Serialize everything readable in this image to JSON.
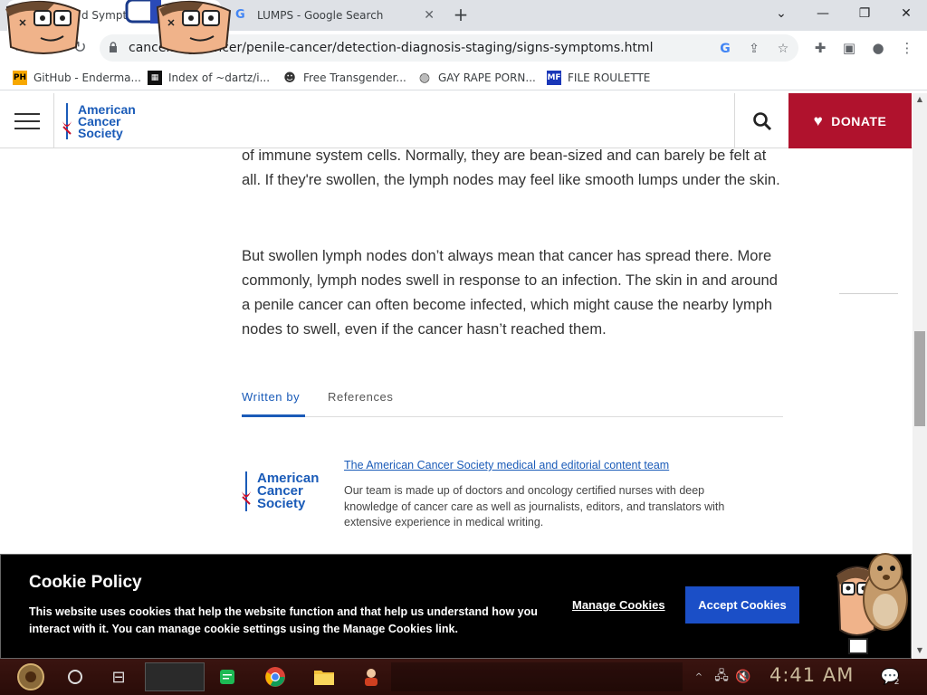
{
  "browser": {
    "tabs": [
      {
        "title": "d Sympto",
        "active": true
      },
      {
        "title": "LUMPS - Google Search",
        "active": false
      }
    ],
    "address_bar": {
      "url": "cancer.org/cancer/penile-cancer/detection-diagnosis-staging/signs-symptoms.html"
    },
    "bookmarks": [
      {
        "label": "GitHub - Enderma...",
        "icon": "ph-favicon"
      },
      {
        "label": "Index of ~dartz/i...",
        "icon": "qr-favicon"
      },
      {
        "label": "Free Transgender...",
        "icon": "mask-favicon"
      },
      {
        "label": "GAY RAPE PORN...",
        "icon": "globe-favicon"
      },
      {
        "label": "FILE ROULETTE",
        "icon": "mf-favicon"
      }
    ]
  },
  "site": {
    "logo_lines": [
      "American",
      "Cancer",
      "Society"
    ],
    "donate_label": "DONATE",
    "colors": {
      "brand_blue": "#1a5bb8",
      "donate_red": "#b0122d",
      "accept_blue": "#1b4fc7"
    }
  },
  "article": {
    "para1": "of immune system cells. Normally, they are bean-sized and can barely be felt at all. If they're swollen, the lymph nodes may feel like smooth lumps under the skin.",
    "para2": "But swollen lymph nodes don’t always mean that cancer has spread there. More commonly, lymph nodes swell in response to an infection. The skin in and around a penile cancer can often become infected, which might cause the nearby lymph nodes to swell, even if the cancer hasn’t reached them.",
    "tabs": [
      "Written by",
      "References"
    ],
    "author_link": "The American Cancer Society medical and editorial content team",
    "author_desc": "Our team is made up of doctors and oncology certified nurses with deep knowledge of cancer care as well as journalists, editors, and translators with extensive experience in medical writing."
  },
  "cookie_banner": {
    "title": "Cookie Policy",
    "text": "This website uses cookies that help the website function and that help us understand how you interact with it. You can manage cookie settings using the Manage Cookies link.",
    "manage_label": "Manage Cookies",
    "accept_label": "Accept Cookies"
  },
  "taskbar": {
    "clock": "4:41 AM",
    "notification_count": "2"
  }
}
